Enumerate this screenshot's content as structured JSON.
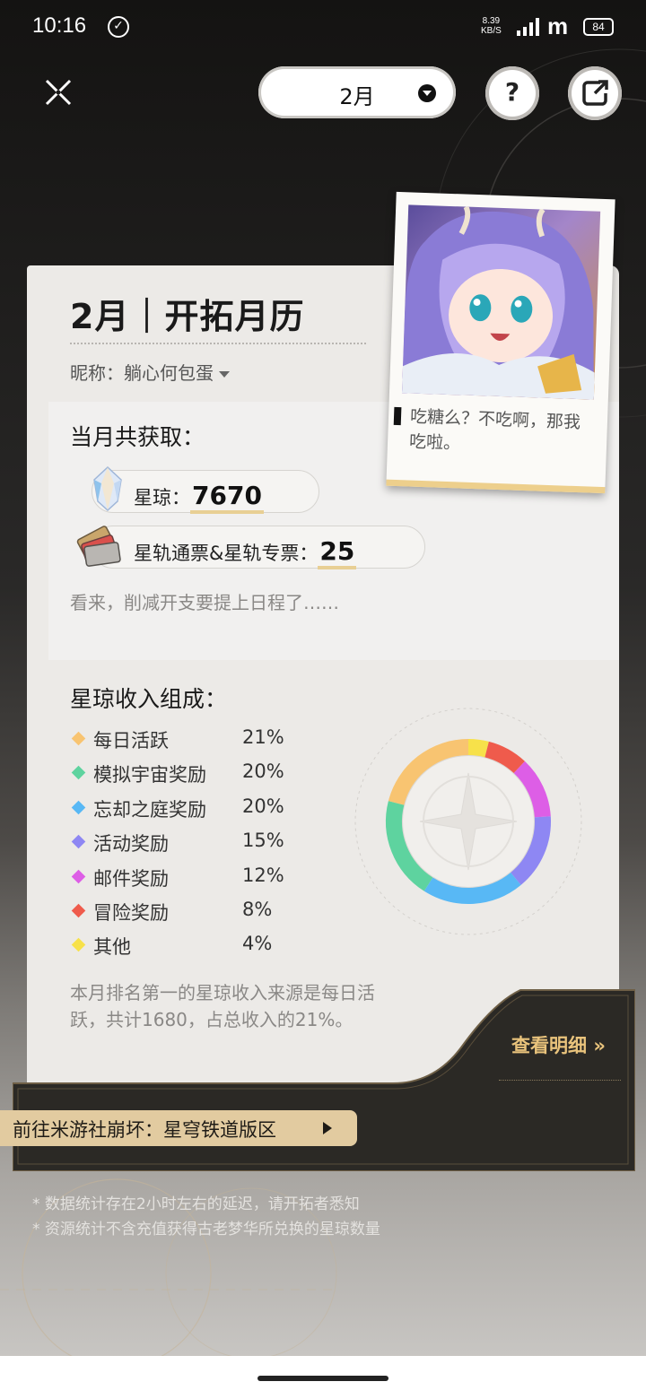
{
  "status_bar": {
    "time": "10:16",
    "net_speed": "8.39",
    "net_unit": "KB/S",
    "carrier_logo": "m",
    "battery": "84"
  },
  "top_bar": {
    "month": "2月",
    "help": "?"
  },
  "card": {
    "title": "2月｜开拓月历",
    "nickname_label": "昵称：",
    "nickname": "躺心何包蛋",
    "earnings_title": "当月共获取：",
    "stellar_jade_label": "星琼：",
    "stellar_jade_value": "7670",
    "pass_label": "星轨通票&星轨专票：",
    "pass_value": "25",
    "earnings_note": "看来，削减开支要提上日程了……",
    "composition_title": "星琼收入组成：",
    "summary": "本月排名第一的星琼收入来源是每日活跃，共计1680，占总收入的21%。"
  },
  "chart_data": {
    "type": "pie",
    "title": "星琼收入组成：",
    "categories": [
      "每日活跃",
      "模拟宇宙奖励",
      "忘却之庭奖励",
      "活动奖励",
      "邮件奖励",
      "冒险奖励",
      "其他"
    ],
    "values": [
      21,
      20,
      20,
      15,
      12,
      8,
      4
    ],
    "labels": [
      "21%",
      "20%",
      "20%",
      "15%",
      "12%",
      "8%",
      "4%"
    ],
    "colors": [
      "#f8c471",
      "#5ed39f",
      "#58b8f5",
      "#8e87f3",
      "#dd5ee6",
      "#ef5b4c",
      "#f7e14a"
    ]
  },
  "photo": {
    "quote": "吃糖么？不吃啊，那我吃啦。"
  },
  "panel": {
    "detail_label": "查看明细",
    "detail_arrow": "»",
    "goto_label": "前往米游社崩坏：星穹铁道版区"
  },
  "footnotes": [
    "* 数据统计存在2小时左右的延迟，请开拓者悉知",
    "* 资源统计不含充值获得古老梦华所兑换的星琼数量"
  ]
}
